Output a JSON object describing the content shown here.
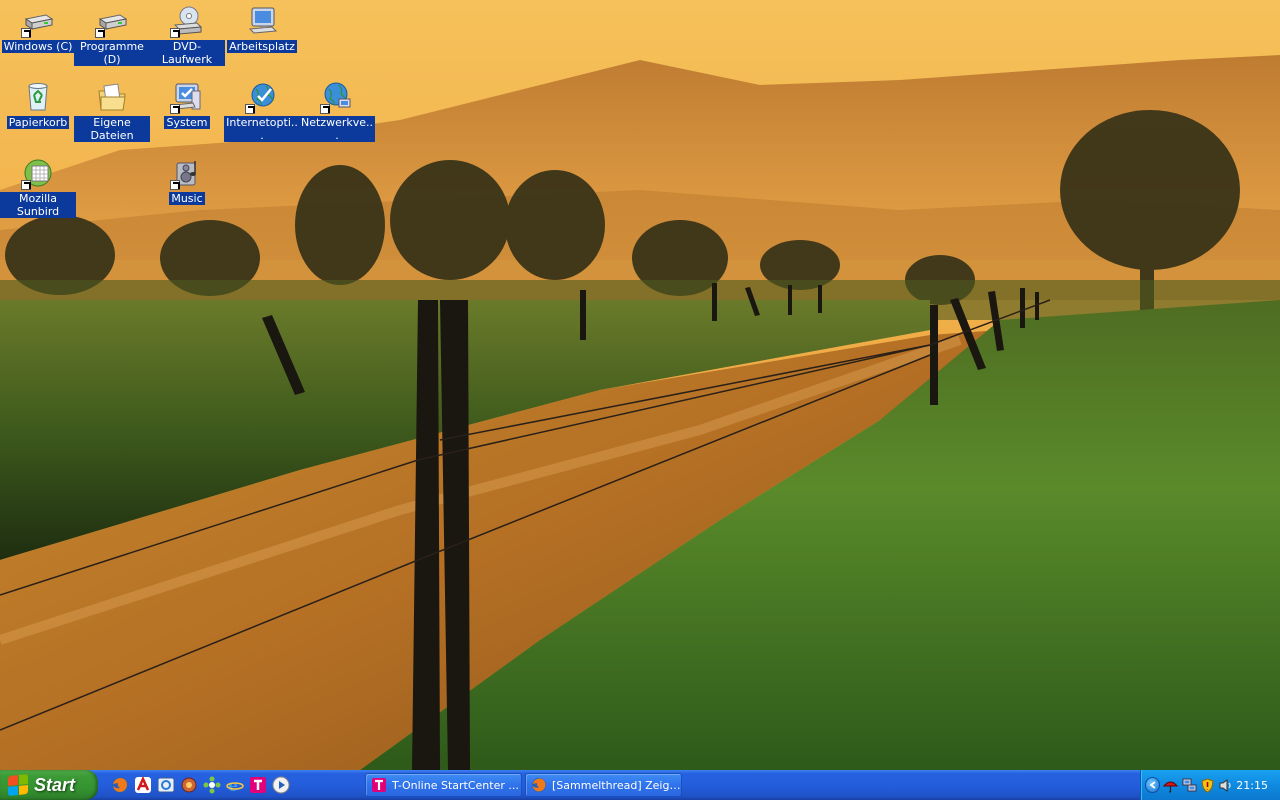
{
  "desktop": {
    "icons": [
      {
        "label": "Windows (C)",
        "icon": "hard-drive-icon",
        "shortcut": true
      },
      {
        "label": "Programme (D)",
        "icon": "hard-drive-icon",
        "shortcut": true
      },
      {
        "label": "DVD-Laufwerk",
        "icon": "dvd-drive-icon",
        "shortcut": true
      },
      {
        "label": "Arbeitsplatz",
        "icon": "my-computer-icon",
        "shortcut": false
      },
      {
        "label": "Papierkorb",
        "icon": "recycle-bin-icon",
        "shortcut": false
      },
      {
        "label": "Eigene Dateien",
        "icon": "my-documents-icon",
        "shortcut": false
      },
      {
        "label": "System",
        "icon": "system-icon",
        "shortcut": true
      },
      {
        "label": "Internetopti...",
        "icon": "internet-options-icon",
        "shortcut": true
      },
      {
        "label": "Netzwerkve...",
        "icon": "network-connections-icon",
        "shortcut": true
      },
      {
        "label": "Mozilla Sunbird",
        "icon": "sunbird-calendar-icon",
        "shortcut": true
      },
      {
        "label": "Music",
        "icon": "music-folder-icon",
        "shortcut": true
      }
    ]
  },
  "taskbar": {
    "start_label": "Start",
    "quicklaunch": [
      {
        "icon": "firefox-icon"
      },
      {
        "icon": "antivir-icon"
      },
      {
        "icon": "hotspot-icon"
      },
      {
        "icon": "network-tool-icon"
      },
      {
        "icon": "gear-flower-icon"
      },
      {
        "icon": "ie-icon"
      },
      {
        "icon": "t-online-icon"
      },
      {
        "icon": "media-player-icon"
      }
    ],
    "tasks": [
      {
        "label": "T-Online StartCenter ...",
        "icon": "t-online-icon"
      },
      {
        "label": "[Sammelthread] Zeigt...",
        "icon": "firefox-icon"
      }
    ],
    "tray": {
      "icons": [
        "show-hidden-icons-chevron",
        "antivir-umbrella-icon",
        "network-icon",
        "shield-icon",
        "volume-icon"
      ],
      "time": "21:15"
    }
  }
}
